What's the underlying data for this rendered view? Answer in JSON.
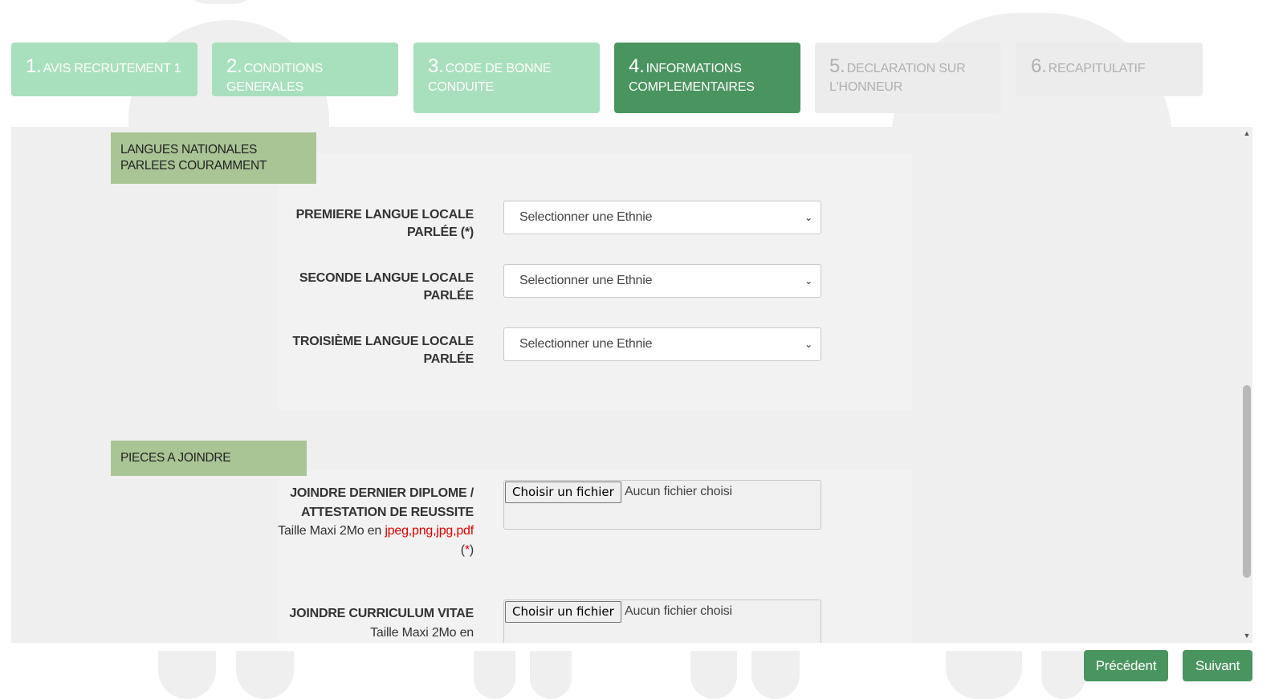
{
  "steps": [
    {
      "num": "1.",
      "label": "AVIS RECRUTEMENT 1",
      "state": "done"
    },
    {
      "num": "2.",
      "label": "CONDITIONS GENERALES",
      "state": "done"
    },
    {
      "num": "3.",
      "label": "CODE DE BONNE CONDUITE",
      "state": "done"
    },
    {
      "num": "4.",
      "label": "INFORMATIONS COMPLEMENTAIRES",
      "state": "active"
    },
    {
      "num": "5.",
      "label": "DECLARATION SUR L'HONNEUR",
      "state": "todo"
    },
    {
      "num": "6.",
      "label": "RECAPITULATIF",
      "state": "todo"
    }
  ],
  "languages_section": {
    "title": "LANGUES NATIONALES PARLEES COURAMMENT",
    "fields": [
      {
        "label": "PREMIERE LANGUE LOCALE PARLÉE",
        "required_mark": "(*)",
        "value": "Selectionner une Ethnie"
      },
      {
        "label": "SECONDE LANGUE LOCALE PARLÉE",
        "value": "Selectionner une Ethnie"
      },
      {
        "label": "TROISIÈME LANGUE LOCALE PARLÉE",
        "value": "Selectionner une Ethnie"
      }
    ]
  },
  "attachments_section": {
    "title": "PIECES A JOINDRE",
    "fields": [
      {
        "label": "JOINDRE DERNIER DIPLOME / ATTESTATION DE REUSSITE",
        "size_note": "Taille Maxi 2Mo en",
        "formats": "jpeg,png,jpg,pdf",
        "required_mark": "*",
        "button": "Choisir un fichier",
        "status": "Aucun fichier choisi"
      },
      {
        "label": "JOINDRE CURRICULUM VITAE",
        "size_note": "Taille Maxi 2Mo en",
        "button": "Choisir un fichier",
        "status": "Aucun fichier choisi"
      }
    ]
  },
  "nav": {
    "previous": "Précédent",
    "next": "Suivant"
  },
  "colors": {
    "done": "#a8e0bd",
    "active": "#4a9460",
    "todo": "#ececec",
    "section": "#aac595",
    "required": "#e00000"
  }
}
